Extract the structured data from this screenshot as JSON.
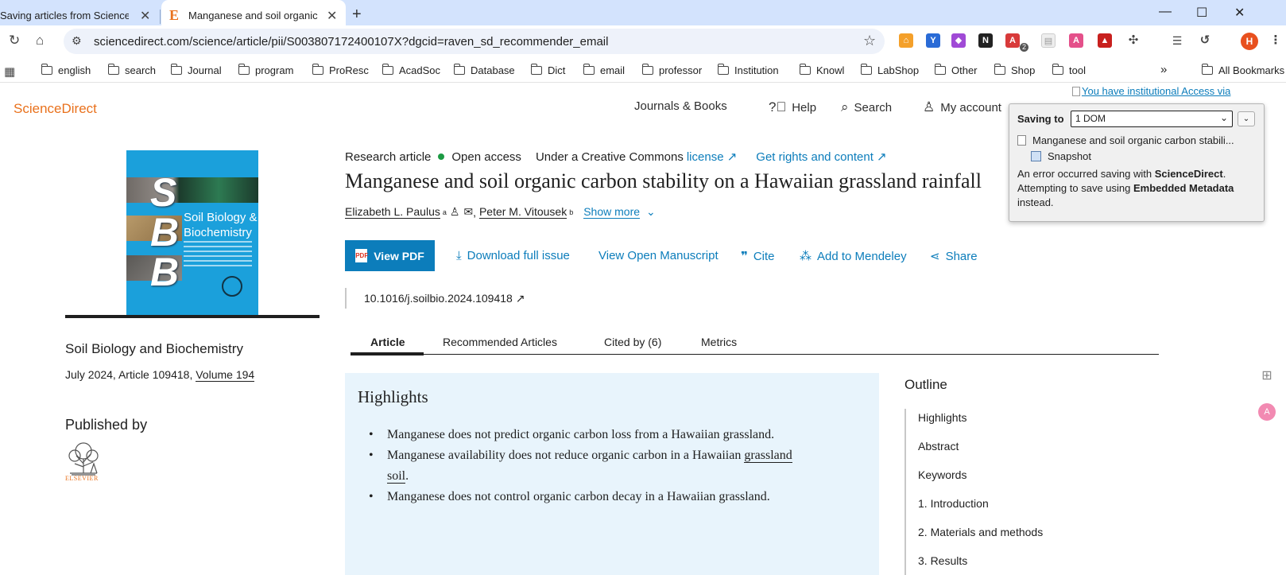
{
  "browser": {
    "tabs": [
      {
        "title": "Saving articles from ScienceD",
        "active": false
      },
      {
        "title": "Manganese and soil organic c",
        "active": true,
        "favicon": "E"
      }
    ],
    "new_tab_icon": "+",
    "url": "sciencedirect.com/science/article/pii/S003807172400107X?dgcid=raven_sd_recommender_email",
    "extension_badge": "2",
    "profile_initial": "H",
    "bookmarks": [
      "english",
      "search",
      "Journal",
      "program",
      "ProResc",
      "AcadSoc",
      "Database",
      "Dict",
      "email",
      "professor",
      "Institution",
      "Knowl",
      "LabShop",
      "Other",
      "Shop",
      "tool"
    ],
    "all_bookmarks_label": "All Bookmarks"
  },
  "site": {
    "logo": "ScienceDirect",
    "nav": {
      "journals_books": "Journals & Books",
      "help": "Help",
      "search": "Search",
      "my_account": "My account"
    },
    "institutional_access": "You have institutional Access via"
  },
  "article": {
    "type": "Research article",
    "access": "Open access",
    "license_prefix": "Under a Creative Commons",
    "license_link": "license ↗",
    "rights_link": "Get rights and content ↗",
    "title": "Manganese and soil organic carbon stability on a Hawaiian grassland rainfall",
    "authors": [
      {
        "name": "Elizabeth L. Paulus",
        "sup": "a"
      },
      {
        "name": "Peter M. Vitousek",
        "sup": "b"
      }
    ],
    "show_more": "Show more",
    "doi": "10.1016/j.soilbio.2024.109418 ↗"
  },
  "actions": {
    "view_pdf": "View PDF",
    "download_issue": "Download full issue",
    "open_manuscript": "View Open Manuscript",
    "cite": "Cite",
    "mendeley": "Add to Mendeley",
    "share": "Share"
  },
  "journal": {
    "cover_letters": [
      "S",
      "B",
      "B"
    ],
    "cover_title_1": "Soil Biology &",
    "cover_title_2": "Biochemistry",
    "name": "Soil Biology and Biochemistry",
    "issue_prefix": "July 2024, Article 109418, ",
    "volume": "Volume 194",
    "published_by": "Published by",
    "publisher": "ELSEVIER"
  },
  "page_tabs": [
    "Article",
    "Recommended Articles",
    "Cited by (6)",
    "Metrics"
  ],
  "highlights": {
    "heading": "Highlights",
    "items": [
      {
        "text": "Manganese does not predict organic carbon loss from a Hawaiian grassland."
      },
      {
        "text_before": "Manganese availability does not reduce organic carbon in a Hawaiian ",
        "keyword": "grassland soil",
        "text_after": "."
      },
      {
        "text": "Manganese does not control organic carbon decay in a Hawaiian grassland."
      }
    ]
  },
  "outline": {
    "heading": "Outline",
    "items": [
      "Highlights",
      "Abstract",
      "Keywords",
      "1. Introduction",
      "2. Materials and methods",
      "3. Results"
    ]
  },
  "zotero": {
    "saving_to_label": "Saving to",
    "collection": "1 DOM",
    "item_title": "Manganese and soil organic carbon stabili...",
    "attachment": "Snapshot",
    "msg_1": "An error occurred saving with ",
    "translator_1": "ScienceDirect",
    "msg_2": ". Attempting to save using ",
    "translator_2": "Embedded Metadata",
    "msg_3": " instead."
  },
  "colors": {
    "brand_orange": "#e9711c",
    "link_blue": "#0c7dbb",
    "tabstrip": "#d3e3fd",
    "highlights_bg": "#e8f4fc"
  }
}
